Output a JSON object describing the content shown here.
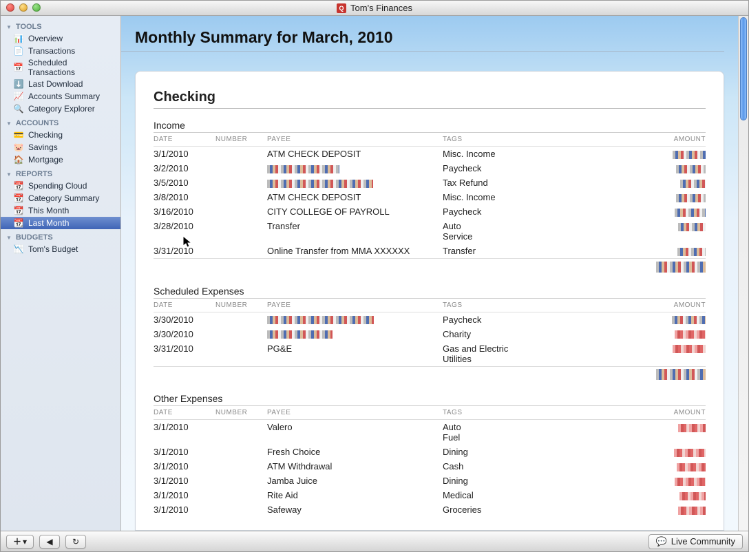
{
  "window": {
    "title": "Tom's Finances",
    "app_icon_letter": "Q"
  },
  "sidebar": {
    "sections": [
      {
        "label": "TOOLS",
        "items": [
          {
            "label": "Overview",
            "icon": "overview"
          },
          {
            "label": "Transactions",
            "icon": "transactions"
          },
          {
            "label": "Scheduled Transactions",
            "icon": "scheduled"
          },
          {
            "label": "Last Download",
            "icon": "download"
          },
          {
            "label": "Accounts Summary",
            "icon": "summary"
          },
          {
            "label": "Category Explorer",
            "icon": "explorer"
          }
        ]
      },
      {
        "label": "ACCOUNTS",
        "items": [
          {
            "label": "Checking",
            "icon": "checking"
          },
          {
            "label": "Savings",
            "icon": "savings"
          },
          {
            "label": "Mortgage",
            "icon": "mortgage"
          }
        ]
      },
      {
        "label": "REPORTS",
        "items": [
          {
            "label": "Spending Cloud",
            "icon": "report"
          },
          {
            "label": "Category Summary",
            "icon": "report"
          },
          {
            "label": "This Month",
            "icon": "report"
          },
          {
            "label": "Last Month",
            "icon": "report",
            "selected": true
          }
        ]
      },
      {
        "label": "BUDGETS",
        "items": [
          {
            "label": "Tom's Budget",
            "icon": "budget"
          }
        ]
      }
    ]
  },
  "page": {
    "title": "Monthly Summary for March, 2010"
  },
  "account": {
    "name": "Checking"
  },
  "columns": {
    "date": "DATE",
    "number": "NUMBER",
    "payee": "PAYEE",
    "tags": "TAGS",
    "amount": "AMOUNT"
  },
  "sections": [
    {
      "title": "Income",
      "rows": [
        {
          "date": "3/1/2010",
          "number": "",
          "payee": "ATM CHECK DEPOSIT",
          "payee_obfuscated": false,
          "tags": "Misc. Income",
          "amount_sign": "pos"
        },
        {
          "date": "3/2/2010",
          "number": "",
          "payee": "",
          "payee_obfuscated": true,
          "tags": "Paycheck",
          "amount_sign": "pos"
        },
        {
          "date": "3/5/2010",
          "number": "",
          "payee": "",
          "payee_obfuscated": true,
          "tags": "Tax Refund",
          "amount_sign": "pos"
        },
        {
          "date": "3/8/2010",
          "number": "",
          "payee": "ATM CHECK DEPOSIT",
          "payee_obfuscated": false,
          "tags": "Misc. Income",
          "amount_sign": "pos"
        },
        {
          "date": "3/16/2010",
          "number": "",
          "payee": "CITY COLLEGE OF PAYROLL",
          "payee_obfuscated": false,
          "tags": "Paycheck",
          "amount_sign": "pos"
        },
        {
          "date": "3/28/2010",
          "number": "",
          "payee": "Transfer",
          "payee_obfuscated": false,
          "tags": "Auto\nService",
          "amount_sign": "pos"
        },
        {
          "date": "3/31/2010",
          "number": "",
          "payee": "Online Transfer from MMA XXXXXX",
          "payee_obfuscated": false,
          "tags": "Transfer",
          "amount_sign": "pos"
        }
      ],
      "total_sign": "pos"
    },
    {
      "title": "Scheduled Expenses",
      "rows": [
        {
          "date": "3/30/2010",
          "number": "",
          "payee": "",
          "payee_obfuscated": true,
          "tags": "Paycheck",
          "amount_sign": "pos"
        },
        {
          "date": "3/30/2010",
          "number": "",
          "payee": "",
          "payee_obfuscated": true,
          "tags": "Charity",
          "amount_sign": "neg"
        },
        {
          "date": "3/31/2010",
          "number": "",
          "payee": "PG&E",
          "payee_obfuscated": false,
          "tags": "Gas and Electric\nUtilities",
          "amount_sign": "neg"
        }
      ],
      "total_sign": "pos"
    },
    {
      "title": "Other Expenses",
      "rows": [
        {
          "date": "3/1/2010",
          "number": "",
          "payee": "Valero",
          "payee_obfuscated": false,
          "tags": "Auto\nFuel",
          "amount_sign": "neg"
        },
        {
          "date": "3/1/2010",
          "number": "",
          "payee": "Fresh Choice",
          "payee_obfuscated": false,
          "tags": "Dining",
          "amount_sign": "neg"
        },
        {
          "date": "3/1/2010",
          "number": "",
          "payee": "ATM Withdrawal",
          "payee_obfuscated": false,
          "tags": "Cash",
          "amount_sign": "neg"
        },
        {
          "date": "3/1/2010",
          "number": "",
          "payee": "Jamba Juice",
          "payee_obfuscated": false,
          "tags": "Dining",
          "amount_sign": "neg"
        },
        {
          "date": "3/1/2010",
          "number": "",
          "payee": "Rite Aid",
          "payee_obfuscated": false,
          "tags": "Medical",
          "amount_sign": "neg"
        },
        {
          "date": "3/1/2010",
          "number": "",
          "payee": "Safeway",
          "payee_obfuscated": false,
          "tags": "Groceries",
          "amount_sign": "neg"
        }
      ],
      "total_sign": null
    }
  ],
  "bottombar": {
    "live_label": "Live Community"
  }
}
